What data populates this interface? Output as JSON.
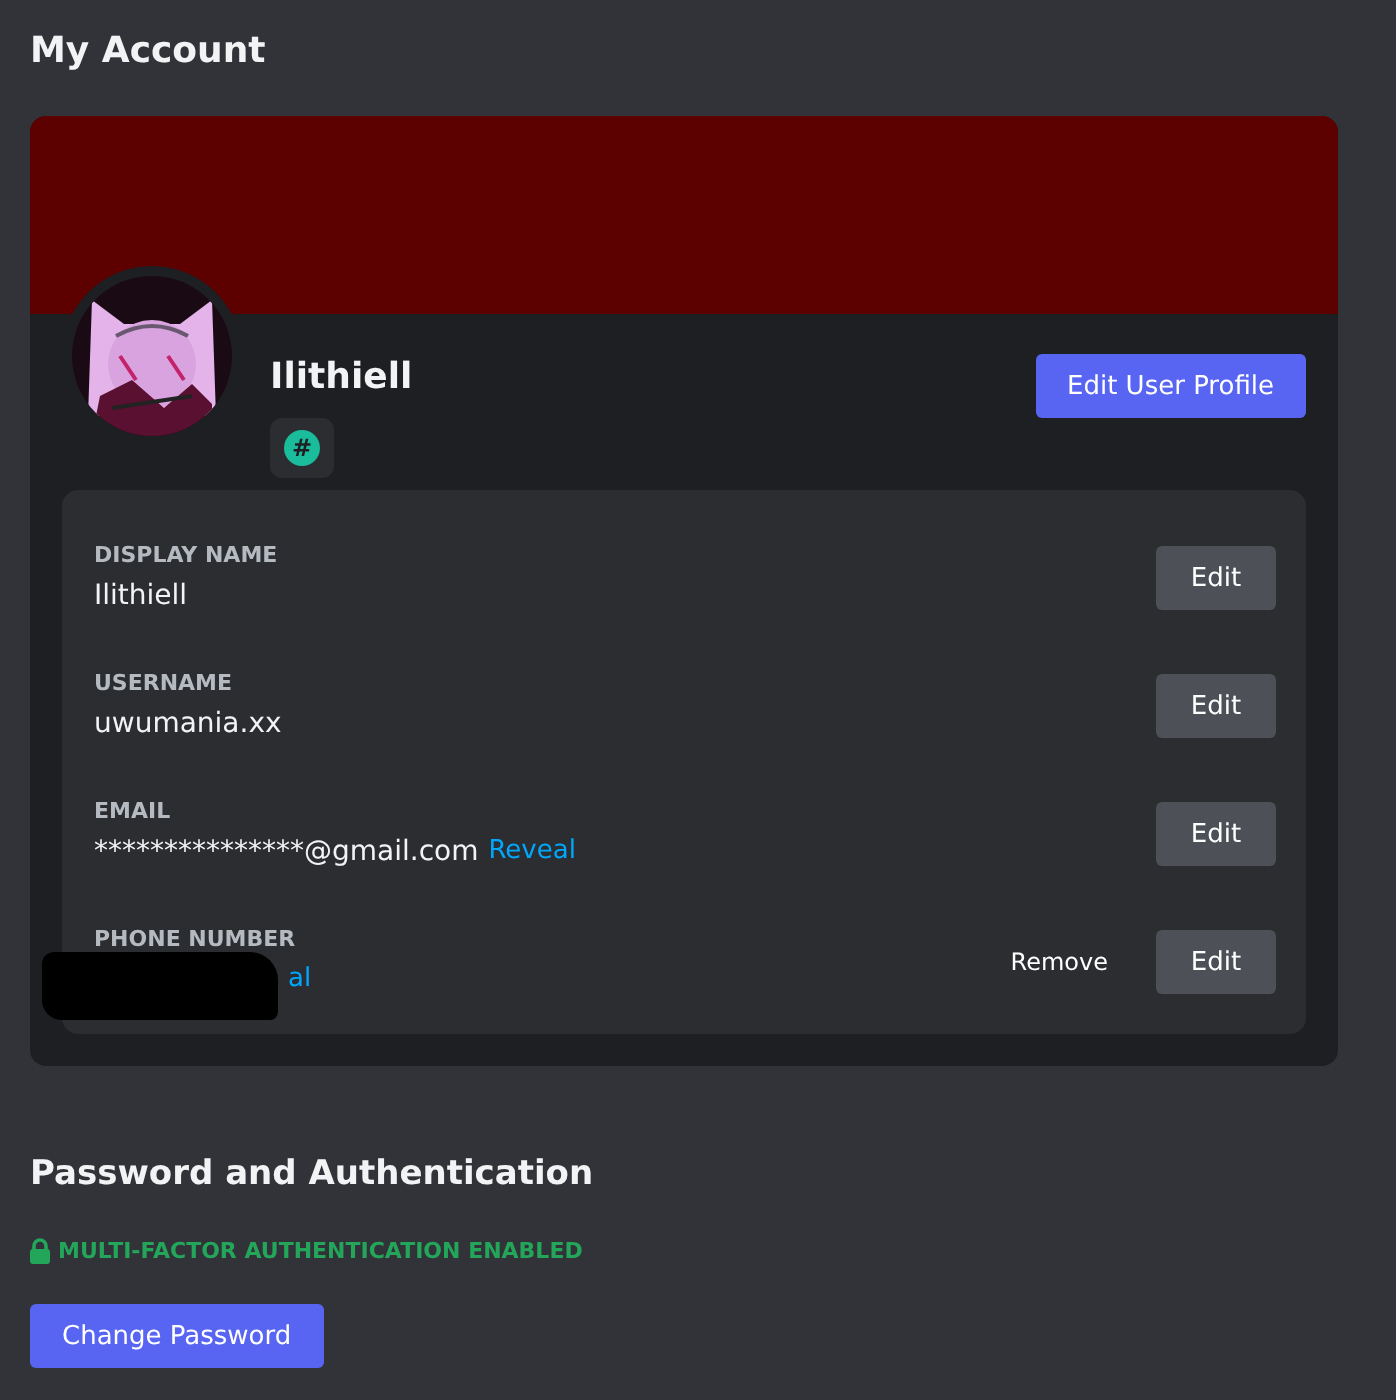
{
  "page_title": "My Account",
  "profile": {
    "name": "Ilithiell",
    "badge": "#",
    "edit_button": "Edit User Profile"
  },
  "fields": [
    {
      "kind": "text",
      "label": "DISPLAY NAME",
      "value": "Ilithiell",
      "actions": [
        "Edit"
      ]
    },
    {
      "kind": "text",
      "label": "USERNAME",
      "value": "uwumania.xx",
      "actions": [
        "Edit"
      ]
    },
    {
      "kind": "text",
      "label": "EMAIL",
      "value": "***************@gmail.com",
      "reveal": "Reveal",
      "actions": [
        "Edit"
      ]
    },
    {
      "kind": "redacted",
      "label": "PHONE NUMBER",
      "reveal": "al",
      "actions": [
        "Remove",
        "Edit"
      ]
    }
  ],
  "security": {
    "title": "Password and Authentication",
    "mfa_status": "MULTI-FACTOR AUTHENTICATION ENABLED",
    "mfa_enabled": true,
    "button": "Change Password"
  }
}
